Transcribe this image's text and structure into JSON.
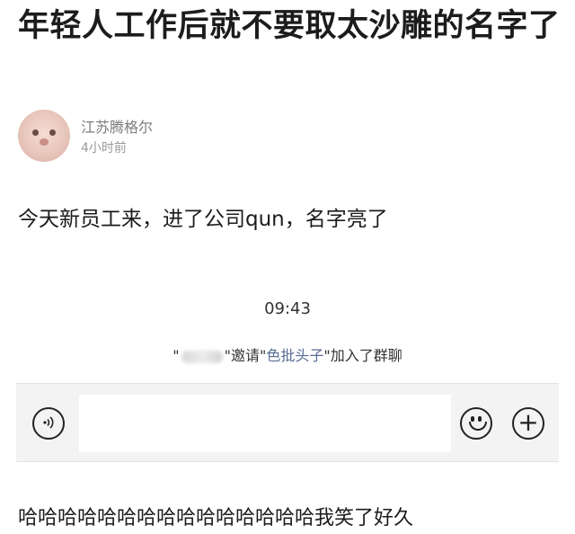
{
  "post": {
    "title": "年轻人工作后就不要取太沙雕的名字了",
    "author": "江苏腾格尔",
    "time": "4小时前",
    "text": "今天新员工来，进了公司qun，名字亮了"
  },
  "chat": {
    "time": "09:43",
    "system_prefix": "\"",
    "system_invite": "\"邀请\"",
    "system_new_member": "色批头子",
    "system_suffix": "\"加入了群聊"
  },
  "input_bar": {
    "voice_icon": "voice-icon",
    "emoji_icon": "emoji-icon",
    "plus_icon": "plus-icon",
    "plus_glyph": "+"
  },
  "comment": "哈哈哈哈哈哈哈哈哈哈哈哈哈哈哈我笑了好久"
}
